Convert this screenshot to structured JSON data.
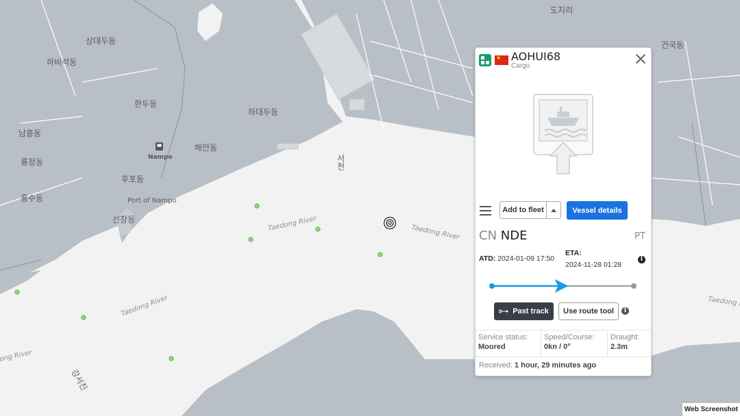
{
  "map": {
    "place_labels": [
      {
        "id": "sangdaedu",
        "text": "상대두동"
      },
      {
        "id": "habiseok",
        "text": "하비석동"
      },
      {
        "id": "handu",
        "text": "한두동"
      },
      {
        "id": "hadaedu",
        "text": "하대두동"
      },
      {
        "id": "namheung",
        "text": "남흥동"
      },
      {
        "id": "ryongjeong",
        "text": "룡정동"
      },
      {
        "id": "haean",
        "text": "해안동"
      },
      {
        "id": "nampo",
        "text": "Nampo"
      },
      {
        "id": "hupo",
        "text": "후포동"
      },
      {
        "id": "port",
        "text": "Port of Nampo"
      },
      {
        "id": "ryongsu",
        "text": "룡수동"
      },
      {
        "id": "seonchang",
        "text": "선창동"
      },
      {
        "id": "dojiri",
        "text": "도지리"
      },
      {
        "id": "geonguk",
        "text": "건국동"
      },
      {
        "id": "seocheon",
        "text": "서천"
      },
      {
        "id": "ganseojin",
        "text": "강서진"
      }
    ],
    "river_labels": [
      {
        "id": "r1",
        "text": "Taedong River"
      },
      {
        "id": "r2",
        "text": "Taedong River"
      },
      {
        "id": "r3",
        "text": "Taedong River"
      },
      {
        "id": "r4",
        "text": "ong River"
      },
      {
        "id": "r5",
        "text": "Taedong Riv"
      }
    ],
    "colors": {
      "water": "#f2f2f2",
      "land": "#b8bfc6",
      "vessel_dot": "#8fd47a",
      "route": "#1a9be0"
    }
  },
  "panel": {
    "vessel_name": "AOHUI68",
    "vessel_type": "Cargo",
    "flag_icon": "china-flag-icon",
    "buttons": {
      "add_fleet": "Add to fleet",
      "vessel_details": "Vessel details",
      "past_track": "Past track",
      "use_route": "Use route tool"
    },
    "origin": {
      "country": "CN",
      "port": "NDE"
    },
    "destination": "PT",
    "atd": {
      "label": "ATD:",
      "value": "2024-01-09 17:50"
    },
    "eta": {
      "label": "ETA:",
      "value": "2024-11-28 01:28"
    },
    "progress": 0.5,
    "stats": [
      {
        "label": "Service status:",
        "value": "Moored"
      },
      {
        "label": "Speed/Course:",
        "value": "0kn / 0°"
      },
      {
        "label": "Draught:",
        "value": "2.3m"
      }
    ],
    "received": {
      "label": "Received:",
      "value": "1 hour, 29 minutes ago"
    }
  },
  "watermark": "Web Screenshot"
}
